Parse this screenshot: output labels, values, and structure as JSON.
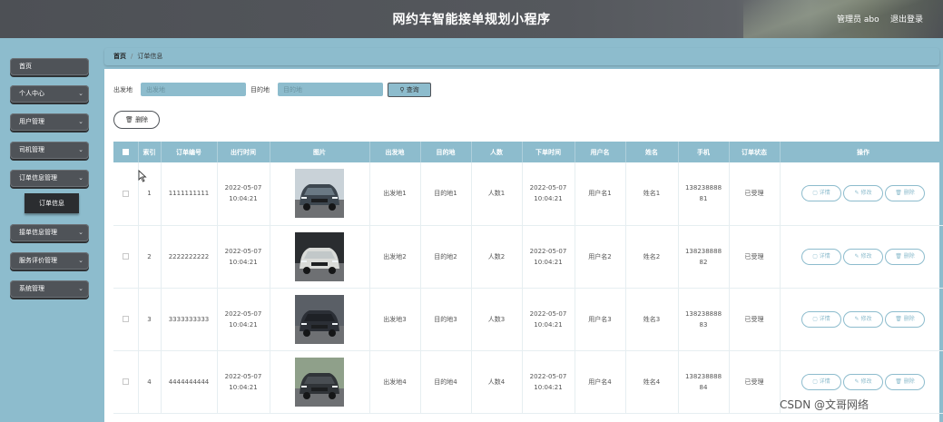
{
  "header": {
    "title": "网约车智能接单规划小程序",
    "user": "管理员 abo",
    "logout": "退出登录"
  },
  "sidebar": {
    "items": [
      {
        "label": "首页",
        "chevron": false
      },
      {
        "label": "个人中心",
        "chevron": true
      },
      {
        "label": "用户管理",
        "chevron": true
      },
      {
        "label": "司机管理",
        "chevron": true
      },
      {
        "label": "订单信息管理",
        "chevron": true
      },
      {
        "label": "接单信息管理",
        "chevron": true
      },
      {
        "label": "服务评价管理",
        "chevron": true
      },
      {
        "label": "系统管理",
        "chevron": true
      }
    ],
    "active_sub": "订单信息"
  },
  "breadcrumb": {
    "home": "首页",
    "current": "订单信息"
  },
  "search": {
    "from_label": "出发地",
    "from_placeholder": "出发地",
    "to_label": "目的地",
    "to_placeholder": "目的地",
    "query_button": "查询",
    "delete_button": "删除"
  },
  "table": {
    "columns": [
      "",
      "索引",
      "订单编号",
      "出行时间",
      "图片",
      "出发地",
      "目的地",
      "人数",
      "下单时间",
      "用户名",
      "姓名",
      "手机",
      "订单状态",
      "操作"
    ],
    "rows": [
      {
        "index": "1",
        "order_no": "1111111111",
        "time": "2022-05-07 10:04:21",
        "from": "出发地1",
        "to": "目的地1",
        "people": "人数1",
        "order_time": "2022-05-07 10:04:21",
        "username": "用户名1",
        "name": "姓名1",
        "phone": "13823888881",
        "status": "已受理"
      },
      {
        "index": "2",
        "order_no": "2222222222",
        "time": "2022-05-07 10:04:21",
        "from": "出发地2",
        "to": "目的地2",
        "people": "人数2",
        "order_time": "2022-05-07 10:04:21",
        "username": "用户名2",
        "name": "姓名2",
        "phone": "13823888882",
        "status": "已受理"
      },
      {
        "index": "3",
        "order_no": "3333333333",
        "time": "2022-05-07 10:04:21",
        "from": "出发地3",
        "to": "目的地3",
        "people": "人数3",
        "order_time": "2022-05-07 10:04:21",
        "username": "用户名3",
        "name": "姓名3",
        "phone": "13823888883",
        "status": "已受理"
      },
      {
        "index": "4",
        "order_no": "4444444444",
        "time": "2022-05-07 10:04:21",
        "from": "出发地4",
        "to": "目的地4",
        "people": "人数4",
        "order_time": "2022-05-07 10:04:21",
        "username": "用户名4",
        "name": "姓名4",
        "phone": "13823888884",
        "status": "已受理"
      }
    ],
    "actions": {
      "detail": "详情",
      "edit": "修改",
      "delete": "删除"
    }
  },
  "watermark": "CSDN @文哥网络",
  "colors": {
    "accent": "#8dbccd",
    "header_bg": "#4d5055",
    "menu_bg": "#4f5358",
    "submenu_bg": "#2b2d30"
  },
  "icons": [
    "search-icon",
    "trash-icon",
    "detail-icon",
    "edit-icon",
    "chevron-down-icon",
    "cursor-icon"
  ]
}
